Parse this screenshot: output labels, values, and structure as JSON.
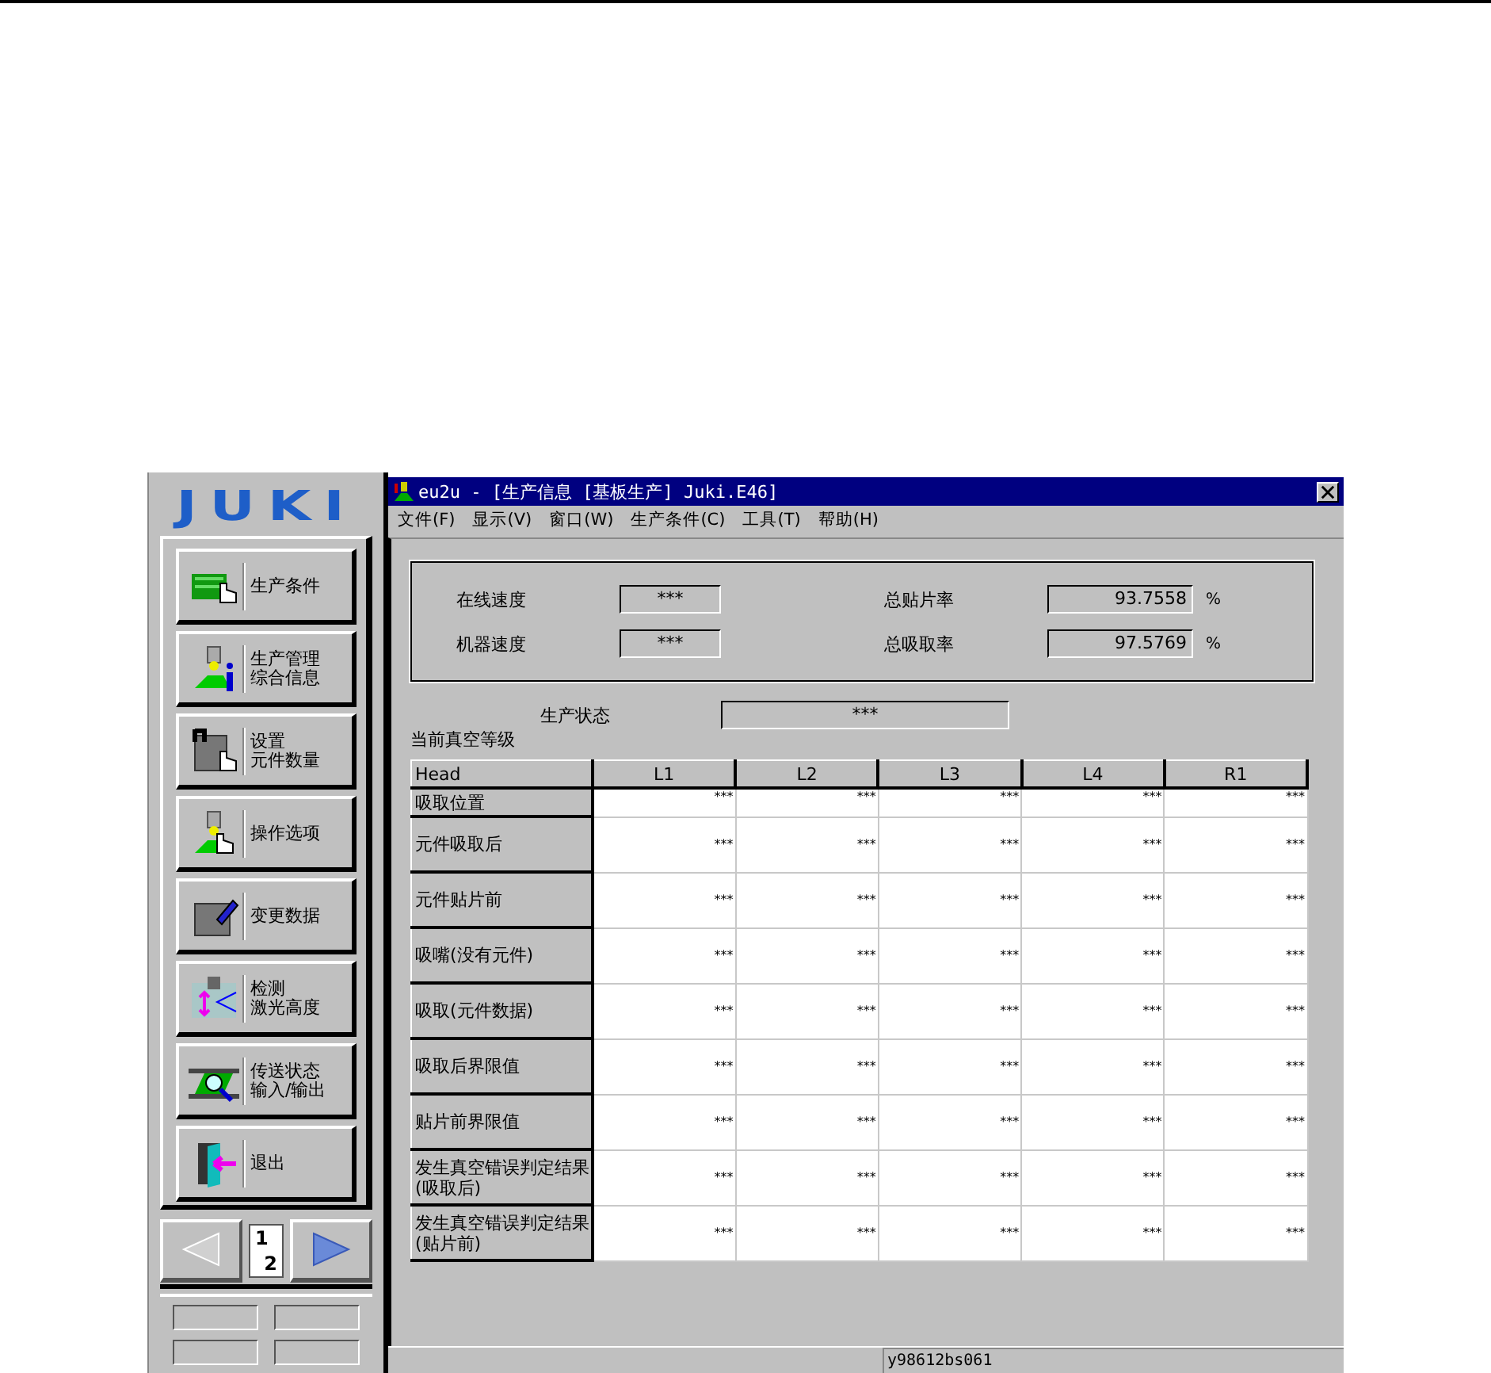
{
  "logo": {
    "text": "JUKI"
  },
  "side_buttons": [
    {
      "kind": "board",
      "lines": [
        "生产条件"
      ]
    },
    {
      "kind": "info",
      "lines": [
        "生产管理",
        "综合信息"
      ]
    },
    {
      "kind": "count",
      "lines": [
        "设置",
        "元件数量"
      ]
    },
    {
      "kind": "options",
      "lines": [
        "操作选项"
      ]
    },
    {
      "kind": "edit",
      "lines": [
        "变更数据"
      ]
    },
    {
      "kind": "laser",
      "lines": [
        "检测",
        "激光高度"
      ]
    },
    {
      "kind": "transfer",
      "lines": [
        "传送状态",
        "输入/输出"
      ]
    },
    {
      "kind": "exit",
      "lines": [
        "退出"
      ]
    }
  ],
  "pager": {
    "prev": {
      "disabled": true
    },
    "numerator": "1",
    "denominator": "2",
    "next": {
      "disabled": false
    }
  },
  "window": {
    "title": "eu2u - [生产信息 [基板生产] Juki.E46]"
  },
  "menu": [
    "文件(F)",
    "显示(V)",
    "窗口(W)",
    "生产条件(C)",
    "工具(T)",
    "帮助(H)"
  ],
  "summary": [
    {
      "label": "在线速度",
      "value": "***"
    },
    {
      "label": "总贴片率",
      "value": "93.7558",
      "unit": "%"
    },
    {
      "label": "机器速度",
      "value": "***"
    },
    {
      "label": "总吸取率",
      "value": "97.5769",
      "unit": "%"
    }
  ],
  "production_status": {
    "label": "生产状态",
    "value": "***"
  },
  "section_title": "当前真空等级",
  "table": {
    "columns": [
      "Head",
      "L1",
      "L2",
      "L3",
      "L4",
      "R1"
    ],
    "rows": [
      {
        "cells": [
          "吸取位置",
          "***",
          "***",
          "***",
          "***",
          "***"
        ]
      },
      {
        "cells": [
          "元件吸取后",
          "***",
          "***",
          "***",
          "***",
          "***"
        ]
      },
      {
        "cells": [
          "元件贴片前",
          "***",
          "***",
          "***",
          "***",
          "***"
        ]
      },
      {
        "cells": [
          "吸嘴(没有元件)",
          "***",
          "***",
          "***",
          "***",
          "***"
        ]
      },
      {
        "cells": [
          "吸取(元件数据)",
          "***",
          "***",
          "***",
          "***",
          "***"
        ]
      },
      {
        "cells": [
          "吸取后界限值",
          "***",
          "***",
          "***",
          "***",
          "***"
        ]
      },
      {
        "cells": [
          "贴片前界限值",
          "***",
          "***",
          "***",
          "***",
          "***"
        ]
      },
      {
        "cells": [
          "发生真空错误判定结果(吸取后)",
          "***",
          "***",
          "***",
          "***",
          "***"
        ]
      },
      {
        "cells": [
          "发生真空错误判定结果(贴片前)",
          "***",
          "***",
          "***",
          "***",
          "***"
        ]
      }
    ]
  },
  "status_bar": {
    "text": "y98612bs061"
  }
}
